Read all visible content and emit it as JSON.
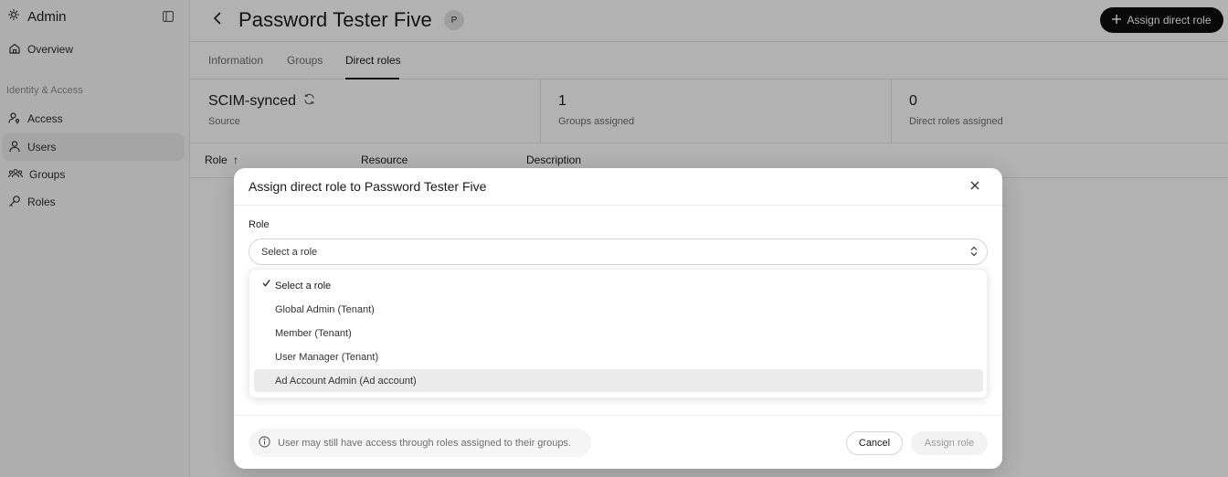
{
  "sidebar": {
    "brand": "Admin",
    "items": [
      {
        "label": "Overview",
        "icon": "home-icon"
      },
      {
        "label": "Access",
        "icon": "user-key-icon"
      },
      {
        "label": "Users",
        "icon": "user-icon"
      },
      {
        "label": "Groups",
        "icon": "users-group-icon"
      },
      {
        "label": "Roles",
        "icon": "key-icon"
      }
    ],
    "section_label": "Identity & Access",
    "active_item": "Users"
  },
  "header": {
    "title": "Password Tester Five",
    "avatar_initial": "P",
    "primary_button": "Assign direct role"
  },
  "tabs": [
    {
      "label": "Information"
    },
    {
      "label": "Groups"
    },
    {
      "label": "Direct roles"
    }
  ],
  "active_tab": "Direct roles",
  "stats": [
    {
      "value": "SCIM-synced",
      "label": "Source"
    },
    {
      "value": "1",
      "label": "Groups assigned"
    },
    {
      "value": "0",
      "label": "Direct roles assigned"
    }
  ],
  "table": {
    "columns": [
      "Role",
      "Resource",
      "Description"
    ],
    "sort_indicator": "↑"
  },
  "modal": {
    "title": "Assign direct role to Password Tester Five",
    "field_label": "Role",
    "select_value": "Select a role",
    "options": [
      "Select a role",
      "Global Admin (Tenant)",
      "Member (Tenant)",
      "User Manager (Tenant)",
      "Ad Account Admin (Ad account)"
    ],
    "selected_option": "Select a role",
    "hovered_option": "Ad Account Admin (Ad account)",
    "info_text": "User may still have access through roles assigned to their groups.",
    "cancel_label": "Cancel",
    "assign_label": "Assign role"
  },
  "colors": {
    "primary_button_bg": "#0d0d0d",
    "overlay": "rgba(0,0,0,0.3)",
    "active_nav_bg": "#ececec"
  }
}
